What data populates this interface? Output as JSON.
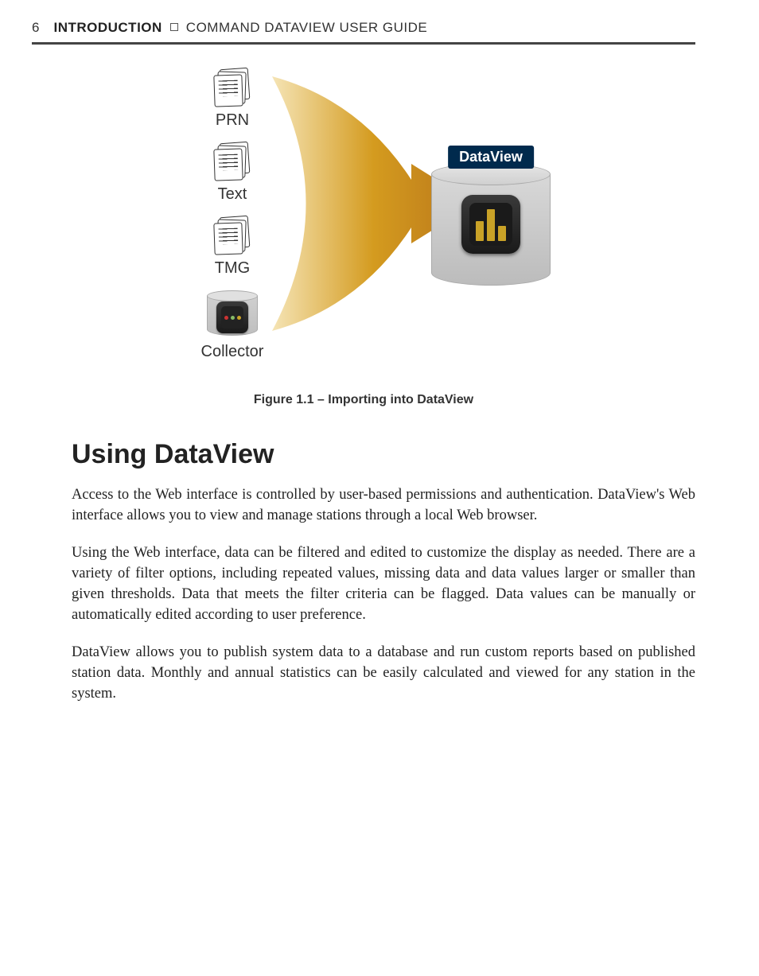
{
  "header": {
    "page_number": "6",
    "section": "INTRODUCTION",
    "doc_title": "COMMAND DATAVIEW USER GUIDE"
  },
  "figure": {
    "sources": [
      "PRN",
      "Text",
      "TMG",
      "Collector"
    ],
    "target_label": "DataView",
    "caption": "Figure 1.1 – Importing into DataView"
  },
  "heading": "Using DataView",
  "paragraphs": [
    "Access to the Web interface is controlled by user-based permissions and authentication. DataView's Web interface allows you to view and manage stations through a local Web browser.",
    "Using the Web interface, data can be filtered and edited to customize the display as needed. There are a variety of filter options, including repeated values, missing data and data values larger or smaller than given thresholds. Data that meets the filter criteria can be flagged. Data values can be manually or automatically edited according to user preference.",
    "DataView allows you to publish system data to a database and run custom reports based on published station data. Monthly and annual statistics can be easily calculated and viewed for any station in the system."
  ]
}
